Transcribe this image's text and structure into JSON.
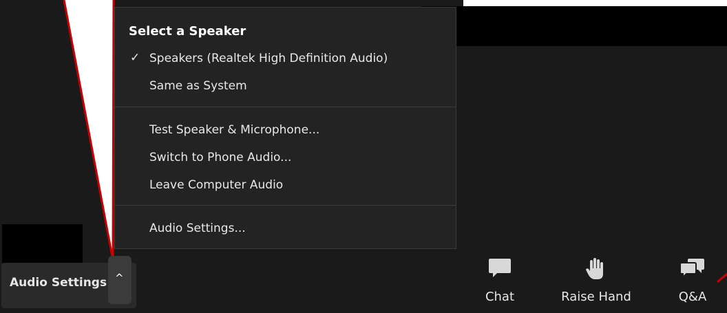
{
  "menu": {
    "title": "Select a Speaker",
    "selected_check": "✓",
    "items_group1": [
      "Speakers (Realtek High Definition Audio)",
      "Same as System"
    ],
    "items_group2": [
      "Test Speaker & Microphone...",
      "Switch to Phone Audio...",
      "Leave Computer Audio"
    ],
    "items_group3": [
      "Audio Settings..."
    ]
  },
  "toolbar": {
    "audio_settings_label": "Audio Settings",
    "caret": "^",
    "chat_label": "Chat",
    "raise_hand_label": "Raise Hand",
    "qa_label": "Q&A"
  },
  "icons": {
    "chat": "chat-bubble-icon",
    "raise_hand": "hand-icon",
    "qa": "qa-bubbles-icon"
  },
  "colors": {
    "background": "#1a1a1a",
    "menu_bg": "#232323",
    "annotation_red": "#cc0000"
  }
}
